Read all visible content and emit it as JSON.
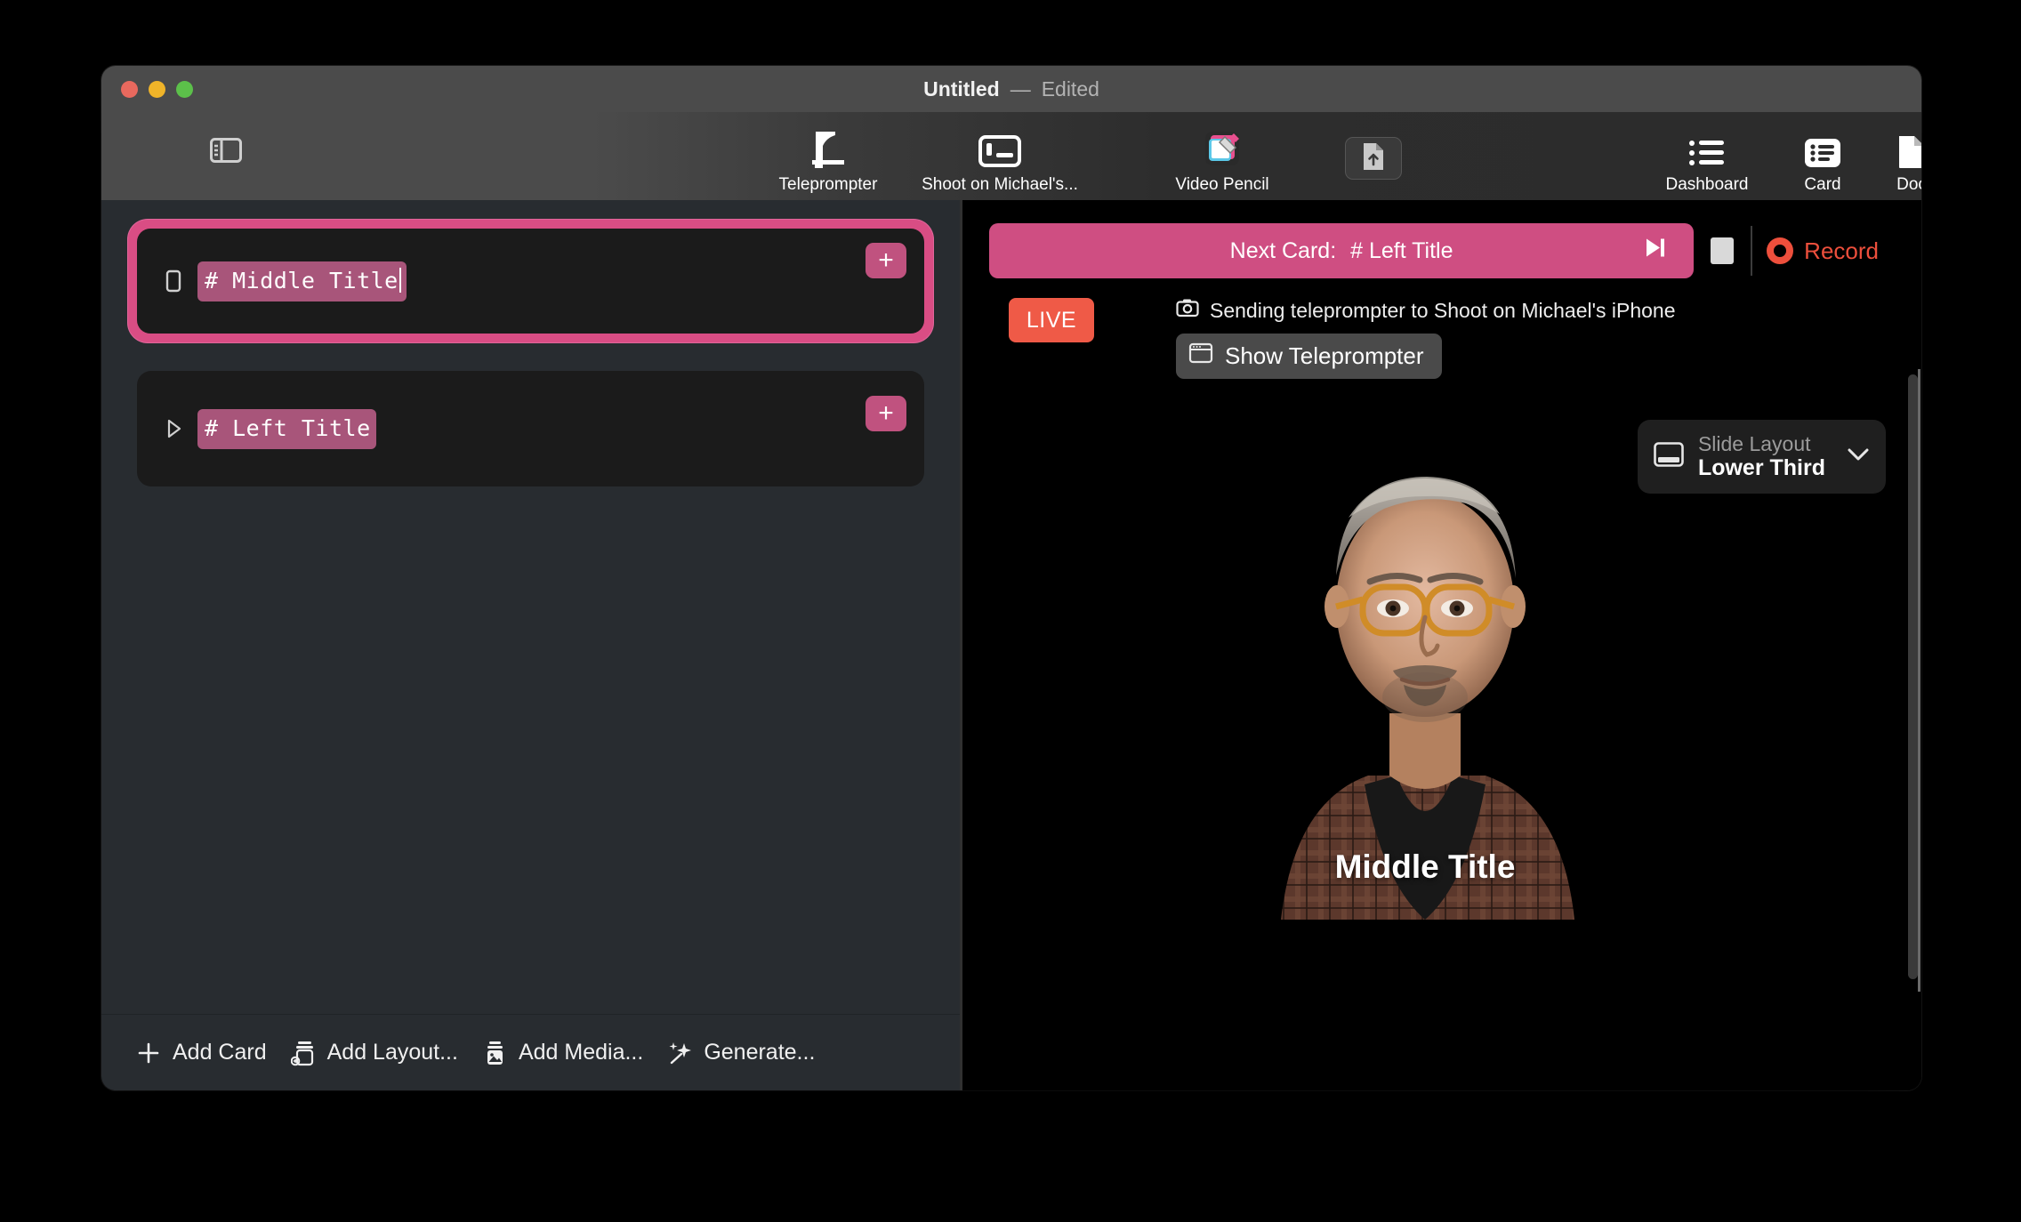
{
  "window": {
    "title_name": "Untitled",
    "title_dash": "—",
    "title_state": "Edited"
  },
  "toolbar": {
    "sidebar_toggle_icon": "sidebar-icon",
    "items": [
      {
        "label": "Teleprompter",
        "icon": "teleprompter-icon"
      },
      {
        "label": "Shoot on Michael's...",
        "icon": "external-display-icon"
      },
      {
        "label": "Video Pencil",
        "icon": "video-pencil-icon"
      }
    ],
    "export_icon": "document-upload-icon",
    "right_items": [
      {
        "label": "Dashboard",
        "icon": "list-dashboard-icon"
      },
      {
        "label": "Card",
        "icon": "card-list-icon"
      },
      {
        "label": "Doc",
        "icon": "document-icon"
      }
    ],
    "search_icon": "search-icon"
  },
  "left_panel": {
    "cards": [
      {
        "text": "# Middle Title",
        "selected": true,
        "bullet_icon": "stop-square-icon",
        "add_label": "+"
      },
      {
        "text": "# Left Title",
        "selected": false,
        "bullet_icon": "play-triangle-icon",
        "add_label": "+"
      }
    ],
    "bottom_bar": [
      {
        "label": "Add Card",
        "icon": "plus-icon"
      },
      {
        "label": "Add Layout...",
        "icon": "layout-stack-icon"
      },
      {
        "label": "Add Media...",
        "icon": "media-image-icon"
      },
      {
        "label": "Generate...",
        "icon": "sparkles-icon"
      }
    ]
  },
  "right_panel": {
    "next_card_prefix": "Next Card:",
    "next_card_value": "# Left Title",
    "skip_icon": "skip-forward-icon",
    "stop_icon": "stop-square-icon",
    "record_label": "Record",
    "record_icon": "record-dot-icon",
    "live_badge": "LIVE",
    "status_text": "Sending teleprompter to Shoot on Michael's iPhone",
    "status_icon": "camera-icon",
    "show_teleprompter_label": "Show Teleprompter",
    "show_teleprompter_icon": "window-icon",
    "overlay_title": "Middle Title",
    "slide_layout": {
      "caption": "Slide Layout",
      "value": "Lower Third",
      "icon": "lower-third-icon",
      "chevron_icon": "chevron-down-icon"
    }
  },
  "colors": {
    "accent_pink": "#d94d84",
    "selection_pink": "#a8557a",
    "record_red": "#ed4f3c",
    "live_red": "#ef5a47",
    "panel_bg": "#282c30",
    "card_bg": "#1b1b1b",
    "titlebar_bg": "#4b4b4b"
  }
}
